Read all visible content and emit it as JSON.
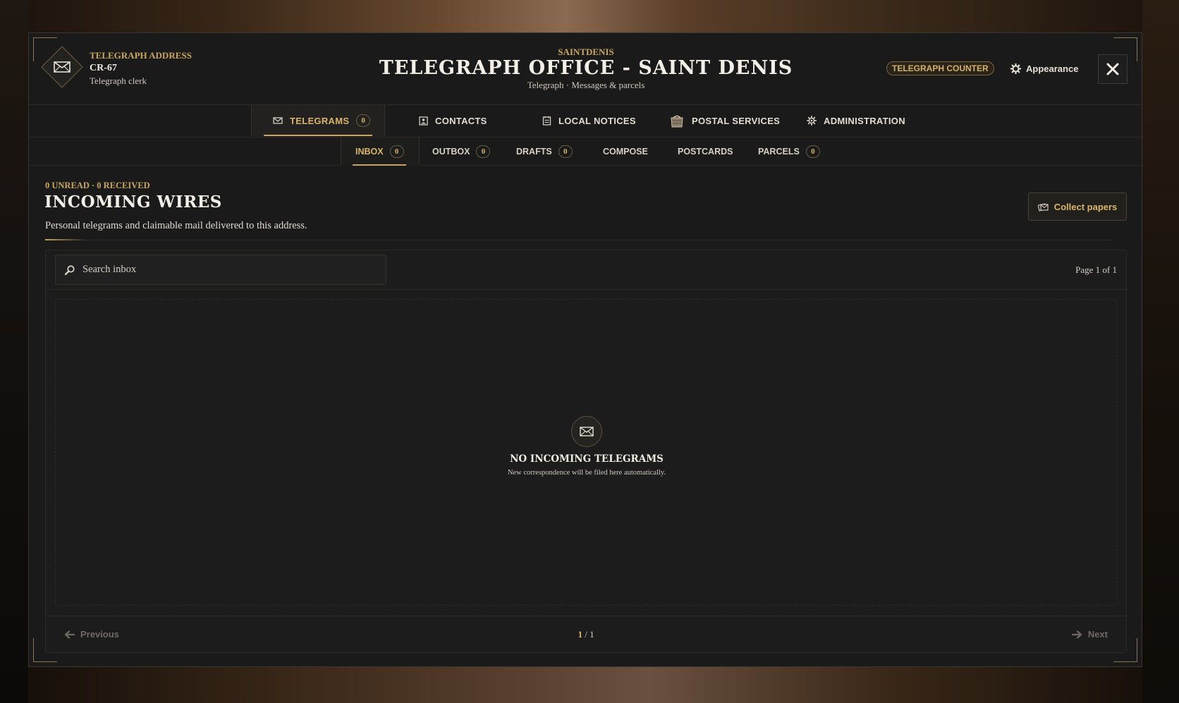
{
  "header": {
    "address_label": "TELEGRAPH ADDRESS",
    "address_code": "CR-67",
    "role": "Telegraph clerk",
    "location": "SAINTDENIS",
    "title": "TELEGRAPH OFFICE - SAINT DENIS",
    "subtitle": "Telegraph · Messages & parcels",
    "counter_badge": "TELEGRAPH COUNTER",
    "appearance_label": "Appearance"
  },
  "tabs": [
    {
      "label": "TELEGRAMS",
      "count": "0",
      "icon": "envelope-icon",
      "active": true
    },
    {
      "label": "CONTACTS",
      "icon": "contact-card-icon"
    },
    {
      "label": "LOCAL NOTICES",
      "icon": "notice-board-icon"
    },
    {
      "label": "POSTAL SERVICES",
      "icon": "mailbag-icon"
    },
    {
      "label": "ADMINISTRATION",
      "icon": "admin-gear-icon"
    }
  ],
  "subtabs": [
    {
      "label": "INBOX",
      "count": "0",
      "active": true
    },
    {
      "label": "OUTBOX",
      "count": "0"
    },
    {
      "label": "DRAFTS",
      "count": "0"
    },
    {
      "label": "COMPOSE"
    },
    {
      "label": "POSTCARDS"
    },
    {
      "label": "PARCELS",
      "count": "0"
    }
  ],
  "section": {
    "stats": "0 UNREAD · 0 RECEIVED",
    "title": "INCOMING WIRES",
    "description": "Personal telegrams and claimable mail delivered to this address.",
    "collect_label": "Collect papers"
  },
  "list": {
    "search_placeholder": "Search inbox",
    "page_info": "Page 1 of 1",
    "empty_title": "NO INCOMING TELEGRAMS",
    "empty_desc": "New correspondence will be filed here automatically."
  },
  "pager": {
    "prev_label": "Previous",
    "next_label": "Next",
    "current": "1",
    "separator": " / ",
    "total": "1"
  },
  "colors": {
    "accent": "#c9a660",
    "panel": "#1a1a1a",
    "text": "#e0dbd0"
  }
}
